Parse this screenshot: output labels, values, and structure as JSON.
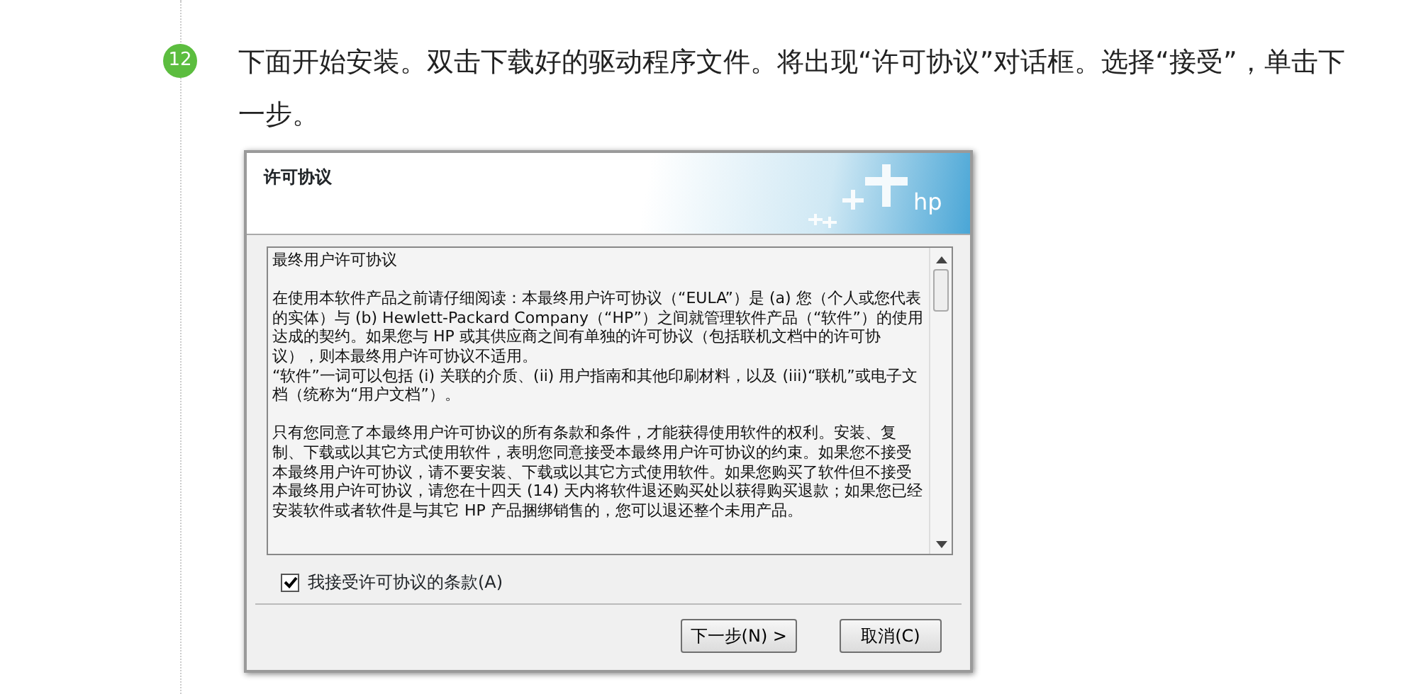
{
  "step": {
    "number": "12",
    "text": "下面开始安装。双击下载好的驱动程序文件。将出现“许可协议”对话框。选择“接受”，单击下一步。"
  },
  "dialog": {
    "title": "许可协议",
    "logo": "hp",
    "license_blocks": [
      [
        "最终用户许可协议"
      ],
      [
        "在使用本软件产品之前请仔细阅读：本最终用户许可协议（“EULA”）是 (a) 您（个人或您代表的实体）与 (b) Hewlett-Packard Company（“HP”）之间就管理软件产品（“软件”）的使用达成的契约。如果您与 HP 或其供应商之间有单独的许可协议（包括联机文档中的许可协议），则本最终用户许可协议不适用。",
        "“软件”一词可以包括 (i) 关联的介质、(ii) 用户指南和其他印刷材料，以及 (iii)“联机”或电子文档（统称为“用户文档”）。"
      ],
      [
        "只有您同意了本最终用户许可协议的所有条款和条件，才能获得使用软件的权利。安装、复制、下载或以其它方式使用软件，表明您同意接受本最终用户许可协议的约束。如果您不接受本最终用户许可协议，请不要安装、下载或以其它方式使用软件。如果您购买了软件但不接受本最终用户许可协议，请您在十四天 (14) 天内将软件退还购买处以获得购买退款；如果您已经安装软件或者软件是与其它 HP 产品捆绑销售的，您可以退还整个未用产品。"
      ]
    ],
    "accept": {
      "label": "我接受许可协议的条款(A)",
      "checked": true
    },
    "buttons": [
      "下一步(N) >",
      "取消(C)"
    ]
  }
}
